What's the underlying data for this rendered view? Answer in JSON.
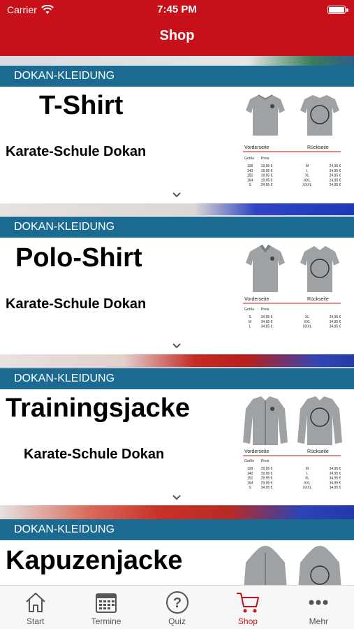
{
  "status_bar": {
    "carrier": "Carrier",
    "time": "7:45 PM"
  },
  "header": {
    "title": "Shop"
  },
  "colors": {
    "brand_red": "#c8101a",
    "label_blue": "#1b6a91"
  },
  "cards": [
    {
      "label": "DOKAN-KLEIDUNG",
      "title": "T-Shirt",
      "subtitle": "Karate-Schule Dokan",
      "image": {
        "front_label": "Vorderseite",
        "back_label": "Rückseite",
        "col_size": "Größe",
        "col_price": "Preis",
        "left_rows": [
          [
            "128",
            "19,95 €"
          ],
          [
            "140",
            "19,95 €"
          ],
          [
            "152",
            "19,95 €"
          ],
          [
            "164",
            "19,95 €"
          ],
          [
            "S",
            "24,95 €"
          ]
        ],
        "right_rows": [
          [
            "M",
            "24,95 €"
          ],
          [
            "L",
            "24,95 €"
          ],
          [
            "XL",
            "24,95 €"
          ],
          [
            "XXL",
            "24,95 €"
          ],
          [
            "XXXL",
            "24,95 €"
          ]
        ]
      }
    },
    {
      "label": "DOKAN-KLEIDUNG",
      "title": "Polo-Shirt",
      "subtitle": "Karate-Schule Dokan",
      "image": {
        "front_label": "Vorderseite",
        "back_label": "Rückseite",
        "col_size": "Größe",
        "col_price": "Preis",
        "left_rows": [
          [
            "S",
            "34,95 €"
          ],
          [
            "M",
            "34,95 €"
          ],
          [
            "L",
            "34,95 €"
          ]
        ],
        "right_rows": [
          [
            "XL",
            "34,95 €"
          ],
          [
            "XXL",
            "34,95 €"
          ],
          [
            "XXXL",
            "34,95 €"
          ]
        ]
      }
    },
    {
      "label": "DOKAN-KLEIDUNG",
      "title": "Trainingsjacke",
      "subtitle": "Karate-Schule Dokan",
      "image": {
        "front_label": "Vorderseite",
        "back_label": "Rückseite",
        "col_size": "Größe",
        "col_price": "Preis",
        "left_rows": [
          [
            "128",
            "29,95 €"
          ],
          [
            "140",
            "29,95 €"
          ],
          [
            "152",
            "29,95 €"
          ],
          [
            "164",
            "29,95 €"
          ],
          [
            "S",
            "34,95 €"
          ]
        ],
        "right_rows": [
          [
            "M",
            "34,95 €"
          ],
          [
            "L",
            "34,95 €"
          ],
          [
            "XL",
            "34,95 €"
          ],
          [
            "XXL",
            "34,95 €"
          ],
          [
            "XXXL",
            "34,95 €"
          ]
        ]
      }
    },
    {
      "label": "DOKAN-KLEIDUNG",
      "title": "Kapuzenjacke"
    }
  ],
  "tabbar": {
    "items": [
      {
        "label": "Start",
        "icon": "house-icon"
      },
      {
        "label": "Termine",
        "icon": "calendar-icon"
      },
      {
        "label": "Quiz",
        "icon": "question-circle-icon"
      },
      {
        "label": "Shop",
        "icon": "cart-icon",
        "active": true
      },
      {
        "label": "Mehr",
        "icon": "more-dots-icon"
      }
    ]
  }
}
